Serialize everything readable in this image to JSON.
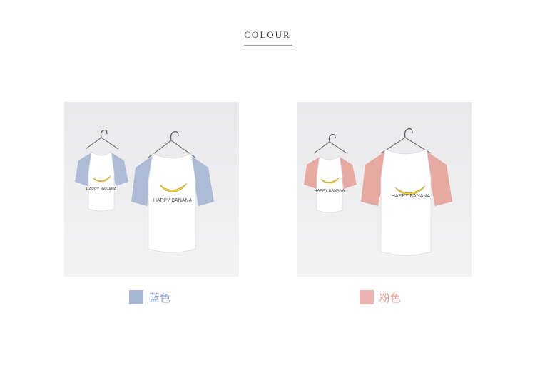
{
  "heading": "COLOUR",
  "variants": [
    {
      "label": "蓝色",
      "swatch_color": "#a8b6d6",
      "label_color": "#8b9cc6",
      "sleeve_color": "#aebbd6",
      "shirt_print": "HAPPY BANANA"
    },
    {
      "label": "粉色",
      "swatch_color": "#ebb3ad",
      "label_color": "#d99a94",
      "sleeve_color": "#e7aaa3",
      "shirt_print": "HAPPY BANANA"
    }
  ]
}
